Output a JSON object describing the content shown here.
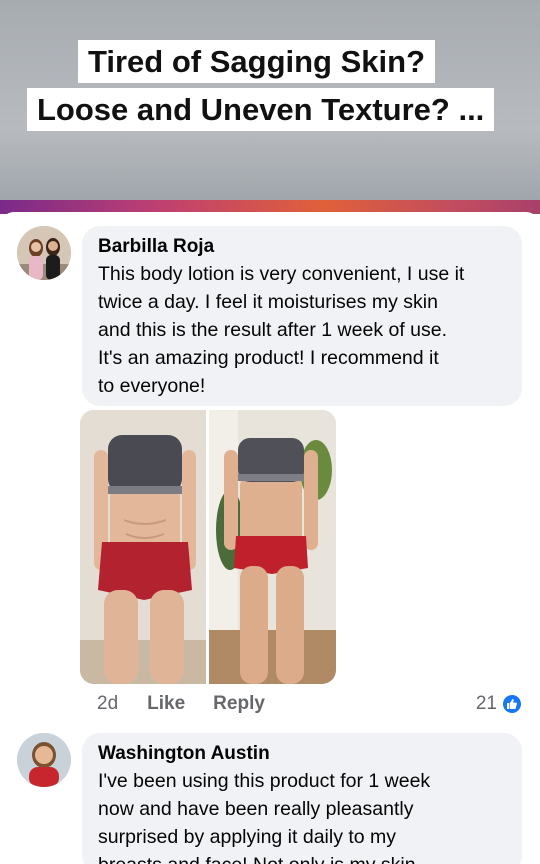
{
  "banner": {
    "headline_line1": "Tired of Sagging Skin?",
    "headline_line2": "Loose and Uneven Texture? ..."
  },
  "comments": [
    {
      "author": "Barbilla Roja",
      "lines": [
        "This body lotion is very convenient, I use it",
        "twice a day. I feel it moisturises my skin",
        "and this is the result after 1 week of use.",
        "It's an amazing product! I recommend it",
        "to everyone!"
      ],
      "time": "2d",
      "like_label": "Like",
      "reply_label": "Reply",
      "reaction_count": "21",
      "reaction_icon": "thumbs-up-icon"
    },
    {
      "author": "Washington Austin",
      "lines": [
        "I've been using this product for 1 week",
        "now and have been really pleasantly",
        "surprised by applying it daily to my",
        "breasts and face! Not only is my skin"
      ]
    }
  ],
  "colors": {
    "bubble": "#f0f2f5",
    "meta_text": "#65676b",
    "like_blue": "#1877f2"
  }
}
